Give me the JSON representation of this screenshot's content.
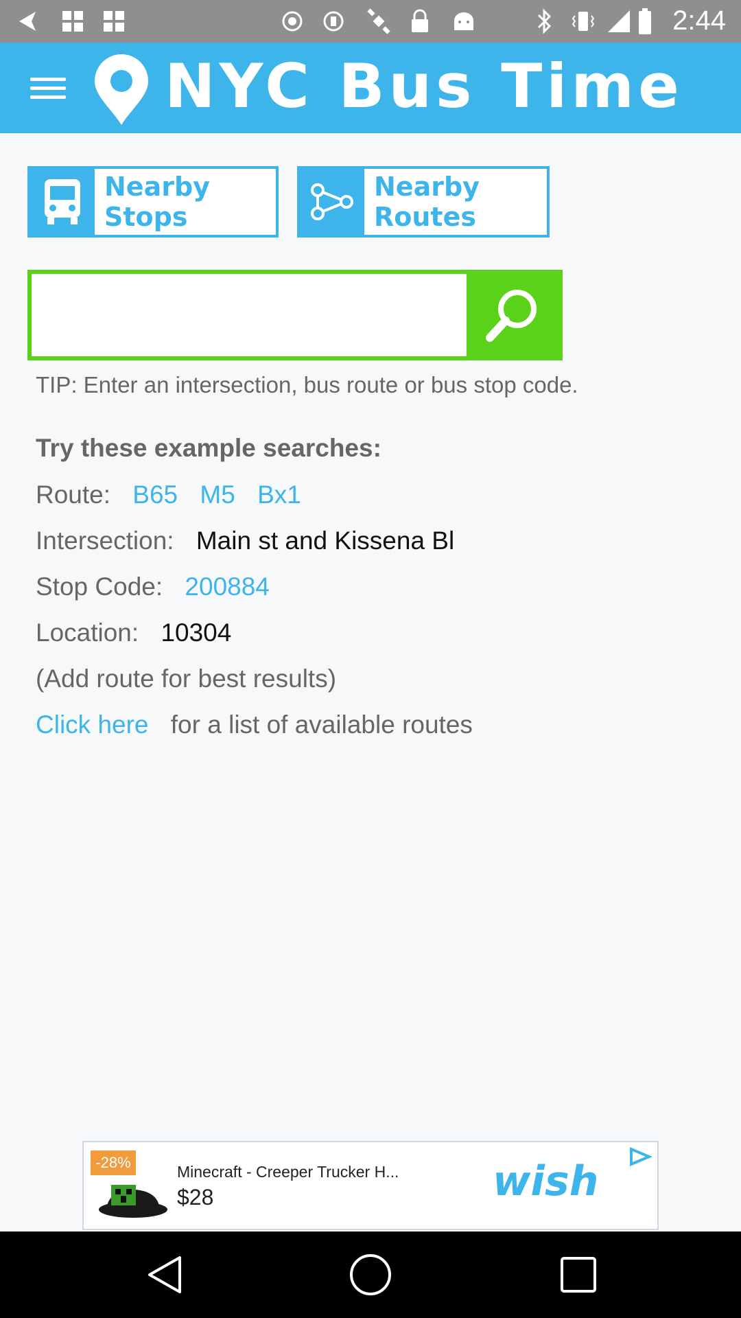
{
  "status_bar": {
    "time": "2:44",
    "icons": [
      "back-arrow-icon",
      "grid-icon",
      "grid-icon",
      "circle-icon",
      "circle-icon",
      "satellite-icon",
      "lock-icon",
      "android-icon",
      "bluetooth-icon",
      "vibrate-icon",
      "signal-icon",
      "battery-icon"
    ]
  },
  "app_bar": {
    "title": "NYC Bus Time",
    "menu_icon": "hamburger-menu-icon",
    "logo_icon": "map-pin-icon",
    "accent": "#3db5ea"
  },
  "nearby": {
    "stops_label": "Nearby Stops",
    "stops_icon": "bus-icon",
    "routes_label": "Nearby Routes",
    "routes_icon": "route-share-icon"
  },
  "search": {
    "value": "",
    "placeholder": "",
    "button_icon": "search-icon",
    "button_color": "#5ad21a"
  },
  "tip": "TIP: Enter an intersection, bus route or bus stop code.",
  "examples": {
    "heading": "Try these example searches:",
    "route_label": "Route:",
    "routes": [
      "B65",
      "M5",
      "Bx1"
    ],
    "intersection_label": "Intersection:",
    "intersection_value": "Main st and Kissena Bl",
    "stop_code_label": "Stop Code:",
    "stop_code_value": "200884",
    "location_label": "Location:",
    "location_value": "10304",
    "hint": "(Add route for best results)",
    "click_here": "Click here",
    "click_here_suffix": "for a list of available routes"
  },
  "ad": {
    "discount": "-28%",
    "title": "Minecraft - Creeper Trucker H...",
    "price": "$28",
    "brand": "wish",
    "play_icon": "ad-play-icon"
  },
  "nav_bar": {
    "icons": [
      "back-icon",
      "home-icon",
      "recents-icon"
    ]
  }
}
